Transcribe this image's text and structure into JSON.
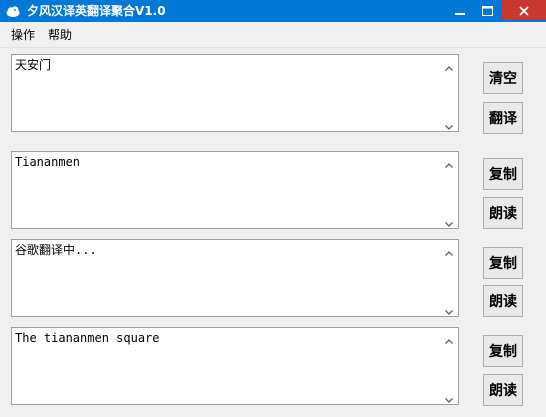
{
  "window": {
    "title": "夕风汉译英翻译聚合V1.0",
    "app_icon": "cloud-icon",
    "controls": [
      "minimize-icon",
      "maximize-icon",
      "close-icon"
    ],
    "accent_color": "#0078d7",
    "close_color": "#c7392f"
  },
  "menu": {
    "items": [
      {
        "label": "操作"
      },
      {
        "label": "帮助"
      }
    ]
  },
  "panels": [
    {
      "text": "天安门",
      "buttons": [
        {
          "label": "清空"
        },
        {
          "label": "翻译"
        }
      ]
    },
    {
      "text": "Tiananmen",
      "buttons": [
        {
          "label": "复制"
        },
        {
          "label": "朗读"
        }
      ]
    },
    {
      "text": "谷歌翻译中...",
      "buttons": [
        {
          "label": "复制"
        },
        {
          "label": "朗读"
        }
      ]
    },
    {
      "text": "The tiananmen square",
      "buttons": [
        {
          "label": "复制"
        },
        {
          "label": "朗读"
        }
      ]
    }
  ]
}
